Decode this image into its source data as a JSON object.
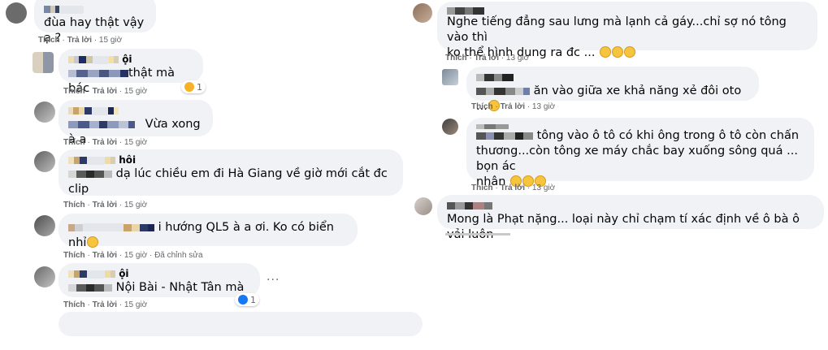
{
  "left": {
    "c1": {
      "text": "đùa hay thật vậy ạ ?",
      "like": "Thích",
      "reply": "Trả lời",
      "time": "15 giờ"
    },
    "c2": {
      "name_tail": "ội",
      "text": "thật mà bác",
      "like": "Thích",
      "reply": "Trả lời",
      "time": "15 giờ",
      "reaction_count": "1"
    },
    "c3": {
      "text": "Vừa xong à a",
      "like": "Thích",
      "reply": "Trả lời",
      "time": "15 giờ"
    },
    "c4": {
      "name_tail": "hôi",
      "text_line1": "dạ lúc chiều em đi Hà Giang về giờ mới cắt đc",
      "text_line2": "clip",
      "like": "Thích",
      "reply": "Trả lời",
      "time": "15 giờ"
    },
    "c5": {
      "text": "i hướng QL5 à a ơi. Ko có biển nhỉ",
      "like": "Thích",
      "reply": "Trả lời",
      "time": "15 giờ",
      "edited": "Đã chỉnh sửa"
    },
    "c6": {
      "name_tail": "ội",
      "text": "Nội Bài - Nhật Tân mà",
      "like": "Thích",
      "reply": "Trả lời",
      "time": "15 giờ",
      "reaction_count": "1"
    }
  },
  "right": {
    "r1": {
      "text_line1": "Nghe tiếng đẳng sau lưng mà lạnh cả gáy...chỉ sợ nó tông vào thì",
      "text_line2": "ko thể hình dung ra đc ...",
      "like": "Thích",
      "reply": "Trả lời",
      "time": "13 giờ"
    },
    "r2": {
      "text": "ăn vào giữa xe khả năng xẻ đôi oto ...",
      "like": "Thích",
      "reply": "Trả lời",
      "time": "13 giờ"
    },
    "r3": {
      "text_line1": "tông vào ô tô có khi ông trong ô tô còn chấn",
      "text_line2": "thương...còn tông xe máy chắc bay xuống sông quá ... bọn ác",
      "text_line3": "nhân",
      "like": "Thích",
      "reply": "Trả lời",
      "time": "13 giờ"
    },
    "r4": {
      "text": "Mong là Phạt nặng... loại này chỉ chạm tí xác định về ô bà ô vải luôn"
    }
  },
  "colors": {
    "bubble": "#f0f2f5",
    "meta": "#65676b",
    "like_blue": "#1877f2",
    "emoji_yellow": "#f7c53d"
  },
  "icons": {
    "haha": "surprised-reaction-icon",
    "like": "like-reaction-icon",
    "more": "more-dots-icon"
  }
}
